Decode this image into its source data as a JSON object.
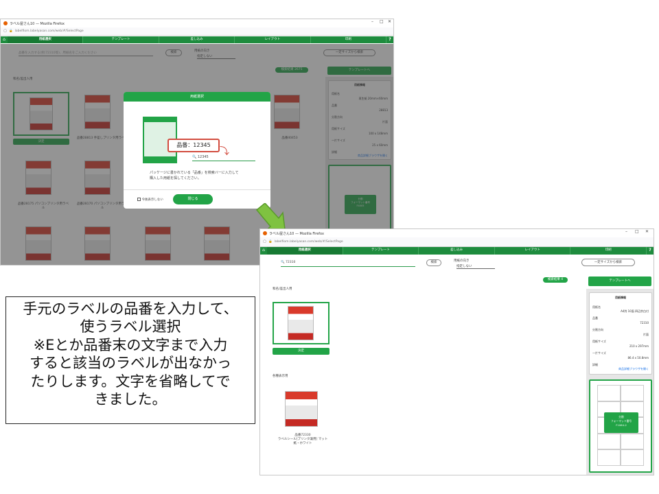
{
  "window1": {
    "title": "ラベル屋さん10 — Mozilla Firefox",
    "url": "labelfiom.labelyasan.com/web/#/SelectPage",
    "steps": [
      "用紙選択",
      "テンプレート",
      "差し込み",
      "レイアウト",
      "印刷"
    ],
    "search_placeholder": "品番を入力する(例:72310等)、用紙名をご入力ください",
    "search_button": "検索",
    "orientation_label": "用紙の向き",
    "orientation_value": "指定しない",
    "size_button": "一定サイズから検索",
    "result_badge": "検索結果 2675",
    "template_button": "テンプレートへ",
    "category": "和名/差出人用",
    "decide_button": "決定",
    "products": [
      "品番28813 手差しプリンタ用ラベル",
      "品番40453",
      "品番28175 パソコンプリンタ用ラベル",
      "品番28170 パソコンプリンタ用ラベル"
    ],
    "info": {
      "header": "用紙情報",
      "rows": [
        "用紙名",
        "品番",
        "分割方向",
        "用紙サイズ",
        "一片サイズ",
        "詳細"
      ],
      "values": [
        "再生紙 20mm×60mm",
        "28813",
        "片面",
        "100 x 148mm",
        "25 x 60mm",
        "商品詳細ブラウザを開く"
      ]
    },
    "preview_button": "分割\nフォーマット番号\nF4005"
  },
  "modal": {
    "title": "用紙選択",
    "example_label": "品番：12345",
    "example_search": "12345",
    "description": "パッケージに書かれている「品番」を検索バーに入力して\n購入した用紙を探してください。",
    "checkbox_label": "今後表示しない",
    "close_button": "閉じる"
  },
  "window2": {
    "title": "ラベル屋さん10 — Mozilla Firefox",
    "url": "labelfiom.labelyasan.com/web/#/SelectPage",
    "steps": [
      "用紙選択",
      "テンプレート",
      "差し込み",
      "レイアウト",
      "印刷"
    ],
    "search_value": "72310",
    "search_button": "検索",
    "orientation_label": "用紙の向き",
    "orientation_value": "指定しない",
    "size_button": "一定サイズから検索",
    "result_badge": "検索結果 4",
    "template_button": "テンプレートへ",
    "category1": "和名/差出人用",
    "decide_button": "決定",
    "category2": "各種表示用",
    "product_name": "品番72330\nラベルシール[プリンタ兼用] マット紙・ホワイト",
    "info": {
      "header": "用紙情報",
      "rows": [
        "用紙名",
        "品番",
        "分割方向",
        "用紙サイズ",
        "一片サイズ",
        "詳細"
      ],
      "values": [
        "A4判 10面 四辺余白付",
        "72310",
        "片面",
        "210 x 297mm",
        "86.4 x 50.8mm",
        "商品詳細ブラウザを開く"
      ]
    },
    "preview_button": "分割\nフォーマット番号\nF1064-2"
  },
  "note": "手元のラベルの品番を入力して、\n使うラベル選択\n※Eとか品番末の文字まで入力\nすると該当のラベルが出なかっ\nたりします。文字を省略してで\nきました。",
  "colors": {
    "green": "#1e8c3e",
    "button_green": "#22a447",
    "arrow": "#7fc241"
  }
}
